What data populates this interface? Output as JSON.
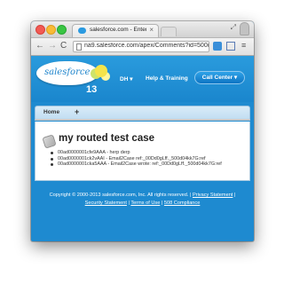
{
  "browser": {
    "tab_title": "salesforce.com - Enterpr",
    "tab_close": "×",
    "url": "na9.salesforce.com/apex/Comments?id=500d0000004kk7G",
    "nav": {
      "back": "←",
      "forward": "→",
      "reload": "C"
    },
    "menu_icon": "≡",
    "fullscreen_icon": "⤢"
  },
  "header": {
    "logo_text": "salesforce",
    "logo_release": "13",
    "user_menu": "DH ▾",
    "help_link": "Help & Training",
    "call_center": "Call Center ▾"
  },
  "tabs": {
    "home": "Home",
    "add": "+"
  },
  "case": {
    "title": "my routed test case",
    "comments": [
      "00ad0000001cfe9AAA - herp derp",
      "00ad0000001ck2vAAI - Email2Case ref:_00Dd0gLff._500d04kk7G:ref",
      "00ad0000001cka5AAA - Email2Case wrote: ref:_00Dd0gLff._500d04kk7G:ref"
    ]
  },
  "footer": {
    "copyright": "Copyright © 2000-2013 salesforce.com, Inc. All rights reserved. |",
    "privacy": "Privacy Statement",
    "security": "Security Statement",
    "terms": "Terms of Use",
    "compliance": "508 Compliance",
    "sep": "|"
  },
  "colors": {
    "page_bg": "#1e8ad0",
    "header_bg": "#2a9bdd",
    "call_center_btn": "#0d74c3",
    "tab_bar": "#c2def2"
  }
}
